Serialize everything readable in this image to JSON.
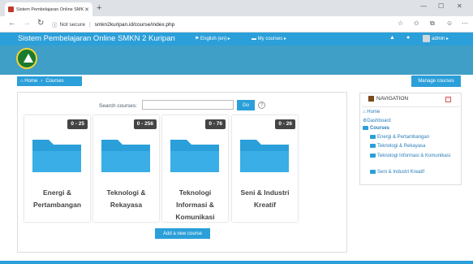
{
  "browser": {
    "tab_title": "Sistem Pembelajaran Online SMK",
    "tab_close": "✕",
    "new_tab": "+",
    "security": "Not secure",
    "url": "smkn2kuripan.id/course/index.php",
    "min": "—",
    "max": "☐",
    "close": "✕",
    "back": "←",
    "forward": "→",
    "reload": "↻",
    "info": "ⓘ",
    "star": "☆",
    "favorites": "✩",
    "collections": "⧉",
    "profile": "☺",
    "more": "⋯"
  },
  "header": {
    "site_name": "Sistem Pembelajaran Online SMKN 2 Kuripan",
    "language": "English (en)",
    "my_courses": "My courses",
    "admin_name": "admin"
  },
  "breadcrumb": {
    "home": "Home",
    "courses": "Courses",
    "separator": "›"
  },
  "manage_courses": "Manage courses",
  "search": {
    "label": "Search courses:",
    "value": "",
    "go": "Go",
    "help": "?"
  },
  "categories": [
    {
      "name": "Energi & Pertambangan",
      "count": "0 - 25"
    },
    {
      "name": "Teknologi & Rekayasa",
      "count": "0 - 256"
    },
    {
      "name": "Teknologi Informasi & Komunikasi",
      "count": "0 - 76"
    },
    {
      "name": "Seni & Industri Kreatif",
      "count": "0 - 26"
    }
  ],
  "add_course": "Add a new course",
  "navigation": {
    "title": "NAVIGATION",
    "collapse": "⊟",
    "home": "Home",
    "dashboard": "Dashboard",
    "courses": "Courses",
    "items": [
      "Energi & Pertambangan",
      "Teknologi & Rekayasa",
      "Teknologi Informasi & Komunikasi",
      "Seni & Industri Kreatif"
    ]
  },
  "colors": {
    "accent": "#2b9fd9",
    "folder": "#2b9fd9",
    "badge": "#444444"
  }
}
